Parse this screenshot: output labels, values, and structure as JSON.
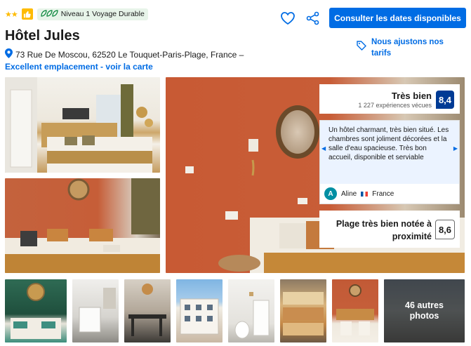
{
  "header": {
    "stars": "★★",
    "sustainability_label": "Niveau 1 Voyage Durable",
    "hotel_name": "Hôtel Jules",
    "address": "73 Rue De Moscou, 62520 Le Touquet-Paris-Plage, France –",
    "location_link": "Excellent emplacement - voir la carte"
  },
  "actions": {
    "save_icon": "heart-icon",
    "share_icon": "share-icon",
    "cta_label": "Consulter les dates disponibles",
    "price_match_label": "Nous ajustons nos tarifs"
  },
  "rating": {
    "label": "Très bien",
    "experiences": "1 227 expériences vécues",
    "score": "8,4"
  },
  "review": {
    "text": "Un hôtel charmant, très bien situé. Les chambres sont joliment décorées et la salle d'eau spacieuse. Très bon accueil, disponible et serviable",
    "avatar_initial": "A",
    "author": "Aline",
    "country": "France",
    "prev_icon": "chevron-left-icon",
    "next_icon": "chevron-right-icon"
  },
  "location_score": {
    "label": "Plage très bien notée à proximité",
    "score": "8,6"
  },
  "gallery": {
    "more_photos_label": "46 autres photos"
  },
  "colors": {
    "brand_blue": "#006ce4",
    "score_blue": "#003b95",
    "accent_yellow": "#febb02",
    "sustain_green": "#008234"
  }
}
